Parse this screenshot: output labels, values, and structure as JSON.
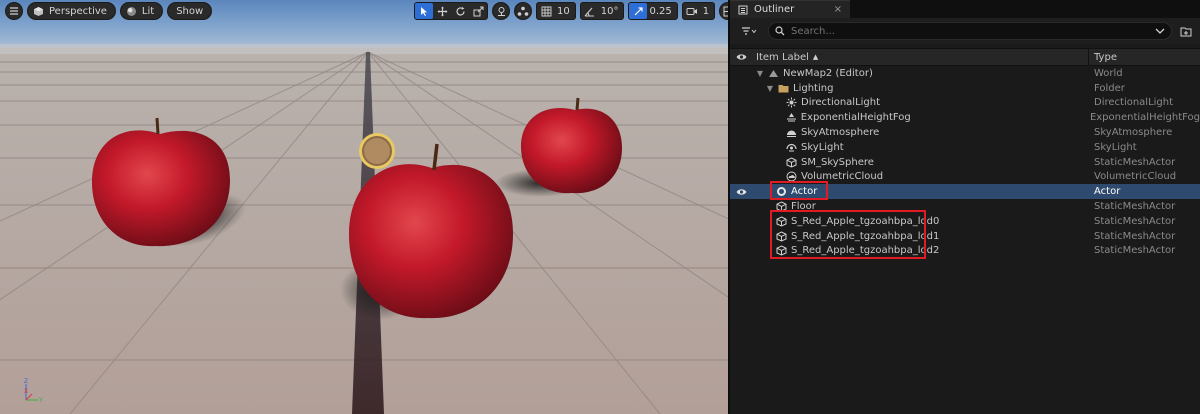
{
  "viewport": {
    "perspective_label": "Perspective",
    "lit_label": "Lit",
    "show_label": "Show",
    "grid_snap_value": "10",
    "rotate_snap_value": "10°",
    "scale_snap_value": "0.25",
    "camera_speed_value": "1",
    "axis_labels": {
      "z": "Z",
      "x": "X",
      "y": "Y"
    }
  },
  "outliner": {
    "tab_title": "Outliner",
    "tab_close": "×",
    "search_placeholder": "Search...",
    "header_item_label": "Item Label",
    "header_sort_glyph": "▲",
    "header_type": "Type",
    "rows": [
      {
        "label": "NewMap2 (Editor)",
        "type": "World"
      },
      {
        "label": "Lighting",
        "type": "Folder"
      },
      {
        "label": "DirectionalLight",
        "type": "DirectionalLight"
      },
      {
        "label": "ExponentialHeightFog",
        "type": "ExponentialHeightFog"
      },
      {
        "label": "SkyAtmosphere",
        "type": "SkyAtmosphere"
      },
      {
        "label": "SkyLight",
        "type": "SkyLight"
      },
      {
        "label": "SM_SkySphere",
        "type": "StaticMeshActor"
      },
      {
        "label": "VolumetricCloud",
        "type": "VolumetricCloud"
      },
      {
        "label": "Actor",
        "type": "Actor"
      },
      {
        "label": "Floor",
        "type": "StaticMeshActor"
      },
      {
        "label": "S_Red_Apple_tgzoahbpa_lod0",
        "type": "StaticMeshActor"
      },
      {
        "label": "S_Red_Apple_tgzoahbpa_lod1",
        "type": "StaticMeshActor"
      },
      {
        "label": "S_Red_Apple_tgzoahbpa_lod2",
        "type": "StaticMeshActor"
      }
    ]
  },
  "colors": {
    "accent_blue": "#2d6fd6",
    "selection": "#2e4a6e",
    "highlight_red": "#e11b22",
    "folder_gold": "#c8a060"
  }
}
